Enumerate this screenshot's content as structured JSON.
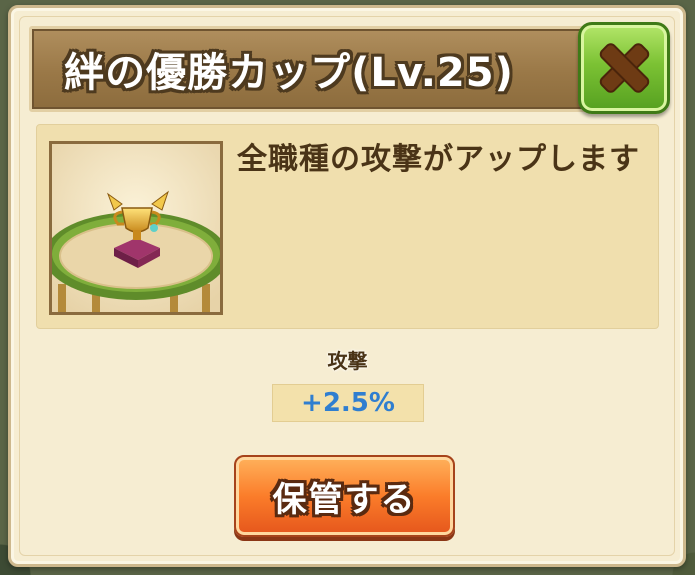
{
  "dialog": {
    "title": "絆の優勝カップ(Lv.25)",
    "close_icon": "close-x-icon"
  },
  "item": {
    "image": "trophy-cup-on-stage-image",
    "description": "全職種の攻撃がアップします"
  },
  "stat": {
    "label": "攻撃",
    "value": "+2.5%"
  },
  "actions": {
    "store_label": "保管する"
  },
  "colors": {
    "title_bar": "#9a7847",
    "close_button": "#7cc234",
    "store_button": "#fb7d2a",
    "stat_value": "#2f7ed0",
    "panel": "#f0dfae"
  }
}
